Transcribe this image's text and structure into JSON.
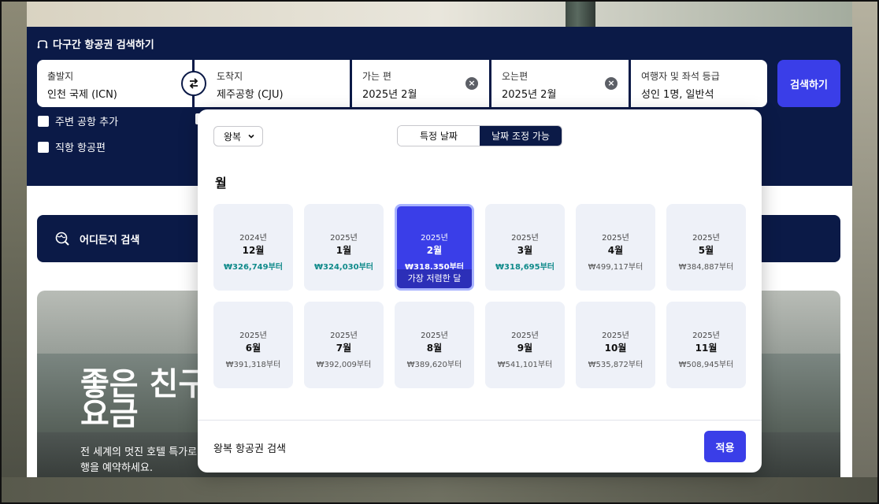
{
  "search": {
    "section_title": "다구간 항공권 검색하기",
    "origin": {
      "label": "출발지",
      "value": "인천 국제 (ICN)"
    },
    "destination": {
      "label": "도착지",
      "value": "제주공항 (CJU)"
    },
    "departure": {
      "label": "가는 편",
      "value": "2025년 2월"
    },
    "return": {
      "label": "오는편",
      "value": "2025년 2월"
    },
    "passengers": {
      "label": "여행자 및 좌석 등급",
      "value": "성인 1명, 일반석"
    },
    "search_button": "검색하기",
    "nearby_airports": "주변 공항 추가",
    "direct_flights": "직항 항공편"
  },
  "explore": {
    "label": "어디든지 검색"
  },
  "hero": {
    "headline_line1": "좋은 친구",
    "headline_line2": "요금",
    "sub_line1": "전 세계의 멋진 호텔 특가로",
    "sub_line2": "행을 예약하세요."
  },
  "popup": {
    "trip_type": "왕복",
    "segment_specific": "특정 날짜",
    "segment_flexible": "날짜 조정 가능",
    "month_heading": "월",
    "months": [
      {
        "year": "2024년",
        "month": "12월",
        "price": "₩326,749부터",
        "deal": true,
        "selected": false
      },
      {
        "year": "2025년",
        "month": "1월",
        "price": "₩324,030부터",
        "deal": true,
        "selected": false
      },
      {
        "year": "2025년",
        "month": "2월",
        "price": "₩318,350부터",
        "deal": true,
        "selected": true
      },
      {
        "year": "2025년",
        "month": "3월",
        "price": "₩318,695부터",
        "deal": true,
        "selected": false
      },
      {
        "year": "2025년",
        "month": "4월",
        "price": "₩499,117부터",
        "deal": false,
        "selected": false
      },
      {
        "year": "2025년",
        "month": "5월",
        "price": "₩384,887부터",
        "deal": false,
        "selected": false
      },
      {
        "year": "2025년",
        "month": "6월",
        "price": "₩391,318부터",
        "deal": false,
        "selected": false
      },
      {
        "year": "2025년",
        "month": "7월",
        "price": "₩392,009부터",
        "deal": false,
        "selected": false
      },
      {
        "year": "2025년",
        "month": "8월",
        "price": "₩389,620부터",
        "deal": false,
        "selected": false
      },
      {
        "year": "2025년",
        "month": "9월",
        "price": "₩541,101부터",
        "deal": false,
        "selected": false
      },
      {
        "year": "2025년",
        "month": "10월",
        "price": "₩535,872부터",
        "deal": false,
        "selected": false
      },
      {
        "year": "2025년",
        "month": "11월",
        "price": "₩508,945부터",
        "deal": false,
        "selected": false
      }
    ],
    "cheapest_badge": "가장 저렴한 달",
    "footer_text": "왕복 항공권 검색",
    "apply_button": "적용"
  },
  "colors": {
    "navy": "#0b1a47",
    "accent": "#3a3ee8",
    "deal_price": "#0f8a8a"
  }
}
